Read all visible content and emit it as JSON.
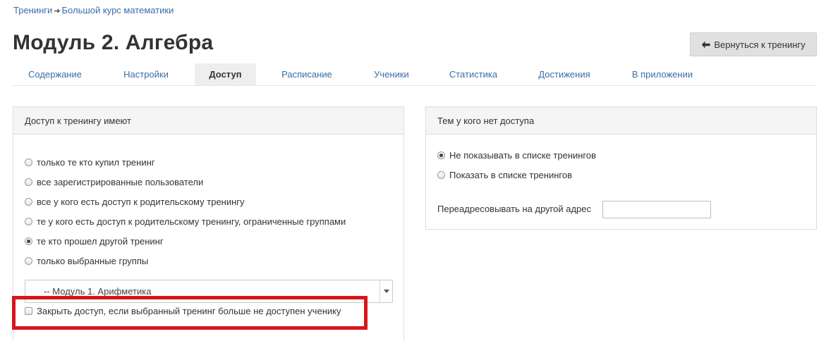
{
  "breadcrumb": {
    "items": [
      "Тренинги",
      "Большой курс математики"
    ],
    "separator": "➔"
  },
  "page": {
    "title": "Модуль 2. Алгебра",
    "back_button_label": "Вернуться к тренингу",
    "back_icon": "arrow-left-icon"
  },
  "tabs": [
    {
      "label": "Содержание",
      "active": false
    },
    {
      "label": "Настройки",
      "active": false
    },
    {
      "label": "Доступ",
      "active": true
    },
    {
      "label": "Расписание",
      "active": false
    },
    {
      "label": "Ученики",
      "active": false
    },
    {
      "label": "Статистика",
      "active": false
    },
    {
      "label": "Достижения",
      "active": false
    },
    {
      "label": "В приложении",
      "active": false
    }
  ],
  "access_panel": {
    "heading": "Доступ к тренингу имеют",
    "options": [
      {
        "label": "только те кто купил тренинг",
        "checked": false
      },
      {
        "label": "все зарегистрированные пользователи",
        "checked": false
      },
      {
        "label": "все у кого есть доступ к родительскому тренингу",
        "checked": false
      },
      {
        "label": "те у кого есть доступ к родительскому тренингу, ограниченные группами",
        "checked": false
      },
      {
        "label": "те кто прошел другой тренинг",
        "checked": true
      },
      {
        "label": "только выбранные группы",
        "checked": false
      }
    ],
    "training_select": {
      "selected": "-- Модуль 1. Арифметика"
    },
    "close_access_checkbox": {
      "label": "Закрыть доступ, если выбранный тренинг больше не доступен ученику",
      "checked": false
    }
  },
  "no_access_panel": {
    "heading": "Тем у кого нет доступа",
    "options": [
      {
        "label": "Не показывать в списке тренингов",
        "checked": true
      },
      {
        "label": "Показать в списке тренингов",
        "checked": false
      }
    ],
    "redirect": {
      "label": "Переадресовывать на другой адрес",
      "value": "",
      "placeholder": ""
    }
  },
  "colors": {
    "link": "#3a6ea5",
    "highlight": "#d9151c",
    "active_tab_bg": "#eeeeee",
    "panel_heading_bg": "#f5f5f5",
    "back_button_bg": "#e0e0e0"
  }
}
